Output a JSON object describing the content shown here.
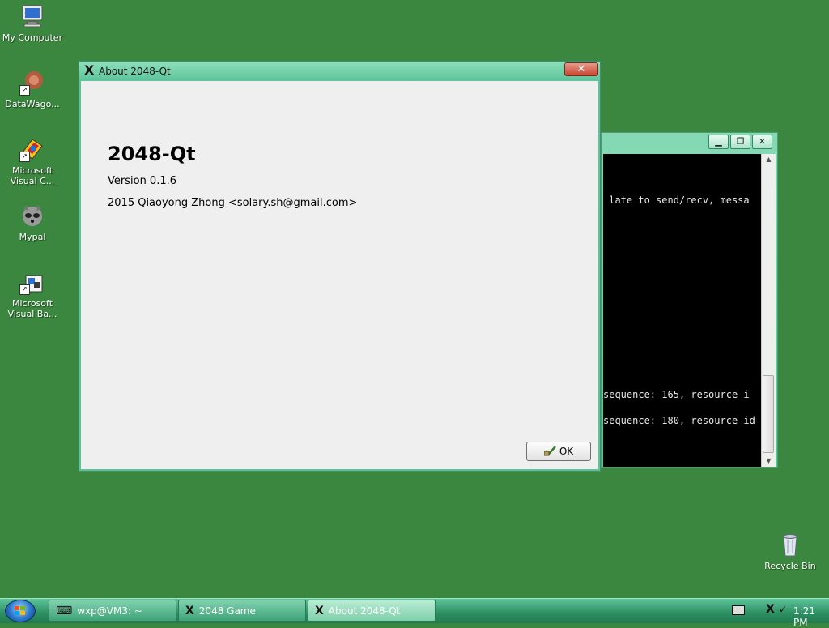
{
  "desktop": {
    "icons": [
      {
        "label": "My Computer",
        "icon": "computer-icon"
      },
      {
        "label": "DataWago...",
        "icon": "datawago-icon"
      },
      {
        "label": "Microsoft Visual C...",
        "icon": "visual-c-icon"
      },
      {
        "label": "Mypal",
        "icon": "mypal-icon"
      },
      {
        "label": "Microsoft Visual Ba...",
        "icon": "visual-basic-icon"
      }
    ],
    "recycle_bin": {
      "label": "Recycle Bin",
      "icon": "recycle-bin-icon"
    }
  },
  "terminal": {
    "lines": [
      " late to send/recv, messa",
      "sequence: 165, resource i",
      "sequence: 180, resource id"
    ]
  },
  "about_dialog": {
    "title": "About 2048-Qt",
    "app_name": "2048-Qt",
    "version": "Version 0.1.6",
    "copyright": "2015 Qiaoyong Zhong <solary.sh@gmail.com>",
    "ok_label": "OK",
    "close_label": "✕"
  },
  "taskbar": {
    "tasks": [
      {
        "label": "wxp@VM3: ~",
        "active": false
      },
      {
        "label": "2048 Game",
        "active": false
      },
      {
        "label": "About 2048-Qt",
        "active": true
      }
    ],
    "clock": "1:21 PM"
  },
  "colors": {
    "desktop": "#3c8740",
    "title_bar": "#5cc39a",
    "close_button": "#c94531"
  }
}
